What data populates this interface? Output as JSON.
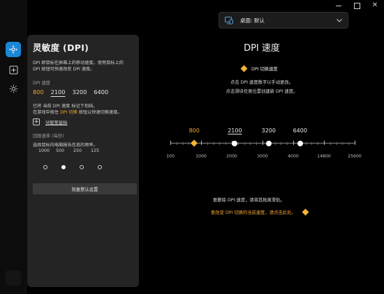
{
  "window": {
    "min_label": "",
    "max_label": "",
    "close_label": "✕"
  },
  "rail": {
    "items": [
      {
        "name": "sensitivity",
        "active": true
      },
      {
        "name": "buttons",
        "active": false
      },
      {
        "name": "lighting",
        "active": false
      }
    ]
  },
  "device_selector": {
    "label": "桌面: 默认"
  },
  "panel": {
    "title": "灵敏度 (DPI)",
    "desc1": "DPI 即鼠标在屏幕上的移动速度。使用鼠标上的",
    "desc2": "DPI 按钮可快速改变 DPI 速度。",
    "dpi_speed_label": "DPI 速度",
    "dpi_values": [
      "800",
      "2100",
      "3200",
      "6400"
    ],
    "marked_note1": "已将 当前 DPI 速度 标记下划线。",
    "marked_note2_a": "在游戏中按住 ",
    "marked_note2_b": "DPI 切换",
    "marked_note2_c": " 按钮以快速切换速度。",
    "assign_label": "分配至鼠标",
    "report_rate_label": "回报速率 (每秒)",
    "report_rate_desc": "选择鼠标向电脑报告信息的频率。",
    "report_rates": [
      "1000",
      "500",
      "250",
      "125"
    ],
    "selected_rate": "500",
    "reset_label": "恢复默认设置"
  },
  "main": {
    "title": "DPI 速度",
    "legend": "DPI 切换速度",
    "instr1": "点击 DPI 速度数字以手动更改。",
    "instr2": "点击滑块任意位置创建新 DPI 速度。",
    "slider": {
      "scale": [
        "100",
        "1000",
        "2000",
        "3000",
        "4000",
        "14800",
        "25600"
      ],
      "points": [
        {
          "label": "800",
          "value": 800,
          "shift": true,
          "current": false
        },
        {
          "label": "2100",
          "value": 2100,
          "shift": false,
          "current": true
        },
        {
          "label": "3200",
          "value": 3200,
          "shift": false,
          "current": false
        },
        {
          "label": "6400",
          "value": 6400,
          "shift": false,
          "current": false
        }
      ]
    },
    "hint1": "要删除 DPI 速度，请将其拖离滑轨。",
    "hint2": "要改变 DPI 切换的当前速度，请点击此处。"
  },
  "colors": {
    "accent": "#1a86d6",
    "orange": "#f2a531",
    "diamond": "#f2b431",
    "panel": "#242424"
  }
}
